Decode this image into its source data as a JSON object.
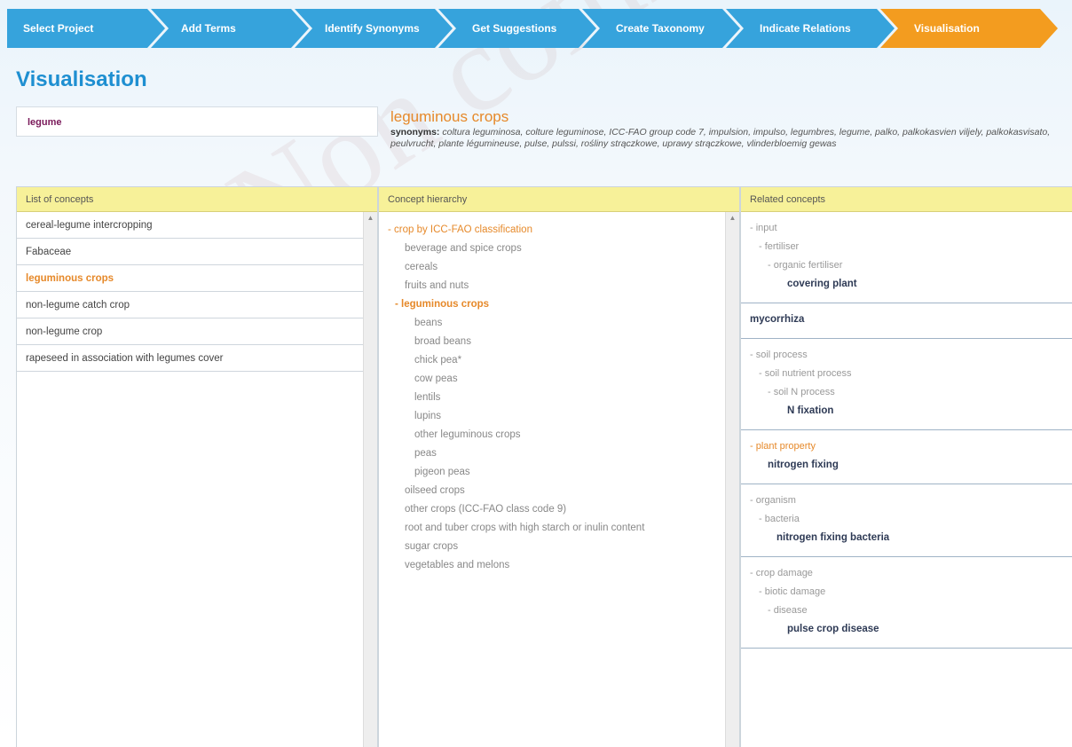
{
  "wizard": {
    "steps": [
      {
        "label": "Select Project",
        "active": false
      },
      {
        "label": "Add Terms",
        "active": false
      },
      {
        "label": "Identify Synonyms",
        "active": false
      },
      {
        "label": "Get Suggestions",
        "active": false
      },
      {
        "label": "Create Taxonomy",
        "active": false
      },
      {
        "label": "Indicate Relations",
        "active": false
      },
      {
        "label": "Visualisation",
        "active": true
      }
    ]
  },
  "page_title": "Visualisation",
  "watermark": "Non commercial",
  "search_term": "legume",
  "concept": {
    "title": "leguminous crops",
    "synonyms_label": "synonyms:",
    "synonyms_text": "coltura leguminosa, colture leguminose, ICC-FAO group code 7, impulsion, impulso, legumbres, legume, palko, palkokasvien viljely, palkokasvisato, peulvrucht, plante légumineuse, pulse, pulssi, rośliny strączkowe, uprawy strączkowe, vlinderbloemig gewas"
  },
  "list_panel": {
    "header": "List of concepts",
    "items": [
      {
        "label": "cereal-legume intercropping",
        "selected": false
      },
      {
        "label": "Fabaceae",
        "selected": false
      },
      {
        "label": "leguminous crops",
        "selected": true
      },
      {
        "label": "non-legume catch crop",
        "selected": false
      },
      {
        "label": "non-legume crop",
        "selected": false
      },
      {
        "label": "rapeseed in association with legumes cover",
        "selected": false
      }
    ]
  },
  "hierarchy_panel": {
    "header": "Concept hierarchy",
    "nodes": [
      {
        "label": "- crop by ICC-FAO classification",
        "level": "l0"
      },
      {
        "label": "beverage and spice crops",
        "level": "l1"
      },
      {
        "label": "cereals",
        "level": "l1"
      },
      {
        "label": "fruits and nuts",
        "level": "l1"
      },
      {
        "label": "- leguminous crops",
        "level": "l1sel"
      },
      {
        "label": "beans",
        "level": "l2"
      },
      {
        "label": "broad beans",
        "level": "l2"
      },
      {
        "label": "chick pea*",
        "level": "l2"
      },
      {
        "label": "cow peas",
        "level": "l2"
      },
      {
        "label": "lentils",
        "level": "l2"
      },
      {
        "label": "lupins",
        "level": "l2"
      },
      {
        "label": "other leguminous crops",
        "level": "l2"
      },
      {
        "label": "peas",
        "level": "l2"
      },
      {
        "label": "pigeon peas",
        "level": "l2"
      },
      {
        "label": "oilseed crops",
        "level": "l1"
      },
      {
        "label": "other crops (ICC-FAO class code 9)",
        "level": "l1"
      },
      {
        "label": "root and tuber crops with high starch or inulin content",
        "level": "l1"
      },
      {
        "label": "sugar crops",
        "level": "l1"
      },
      {
        "label": "vegetables and melons",
        "level": "l1"
      }
    ]
  },
  "related_panel": {
    "header": "Related concepts",
    "groups": [
      {
        "lines": [
          {
            "text": "- input",
            "indent": 0
          },
          {
            "text": "- fertiliser",
            "indent": 1
          },
          {
            "text": "- organic fertiliser",
            "indent": 2
          },
          {
            "text": "covering plant",
            "indent": 3,
            "term": true
          }
        ]
      },
      {
        "lines": [
          {
            "text": "mycorrhiza",
            "indent": 0,
            "term": true
          }
        ]
      },
      {
        "lines": [
          {
            "text": "- soil process",
            "indent": 0
          },
          {
            "text": "- soil nutrient process",
            "indent": 1
          },
          {
            "text": "- soil N process",
            "indent": 2
          },
          {
            "text": "N fixation",
            "indent": 3,
            "term": true
          }
        ]
      },
      {
        "lines": [
          {
            "text": "- plant property",
            "indent": 0,
            "orange": true
          },
          {
            "text": "nitrogen fixing",
            "indent": 1,
            "term": true
          }
        ]
      },
      {
        "lines": [
          {
            "text": "- organism",
            "indent": 0
          },
          {
            "text": "- bacteria",
            "indent": 1
          },
          {
            "text": "nitrogen fixing bacteria",
            "indent": 2,
            "term": true
          }
        ]
      },
      {
        "lines": [
          {
            "text": "- crop damage",
            "indent": 0
          },
          {
            "text": "- biotic damage",
            "indent": 1
          },
          {
            "text": "- disease",
            "indent": 2
          },
          {
            "text": "pulse crop disease",
            "indent": 3,
            "term": true
          }
        ]
      }
    ]
  },
  "colors": {
    "accent_blue": "#36a3dc",
    "accent_orange": "#f39c1f",
    "title_blue": "#1e8fd1",
    "panel_header_yellow": "#f7f199"
  }
}
